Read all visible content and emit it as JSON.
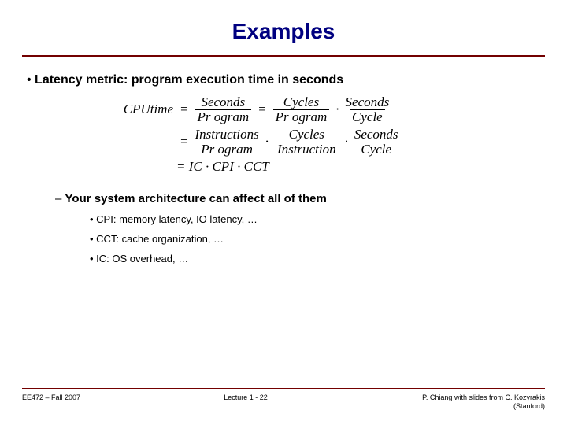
{
  "title": "Examples",
  "bullet1": "Latency metric: program execution time in seconds",
  "eq": {
    "lhs": "CPUtime",
    "eqsign": "=",
    "seconds": "Seconds",
    "program": "Pr ogram",
    "cycles": "Cycles",
    "cycle": "Cycle",
    "instructions": "Instructions",
    "instruction": "Instruction",
    "final": "= IC · CPI · CCT"
  },
  "bullet2": "Your system architecture can affect all of them",
  "b3a": "CPI: memory latency, IO latency, …",
  "b3b": "CCT: cache organization, …",
  "b3c": "IC: OS overhead, …",
  "footer": {
    "left": "EE472 – Fall 2007",
    "center": "Lecture 1 - 22",
    "right": "P. Chiang with slides from C. Kozyrakis (Stanford)"
  }
}
